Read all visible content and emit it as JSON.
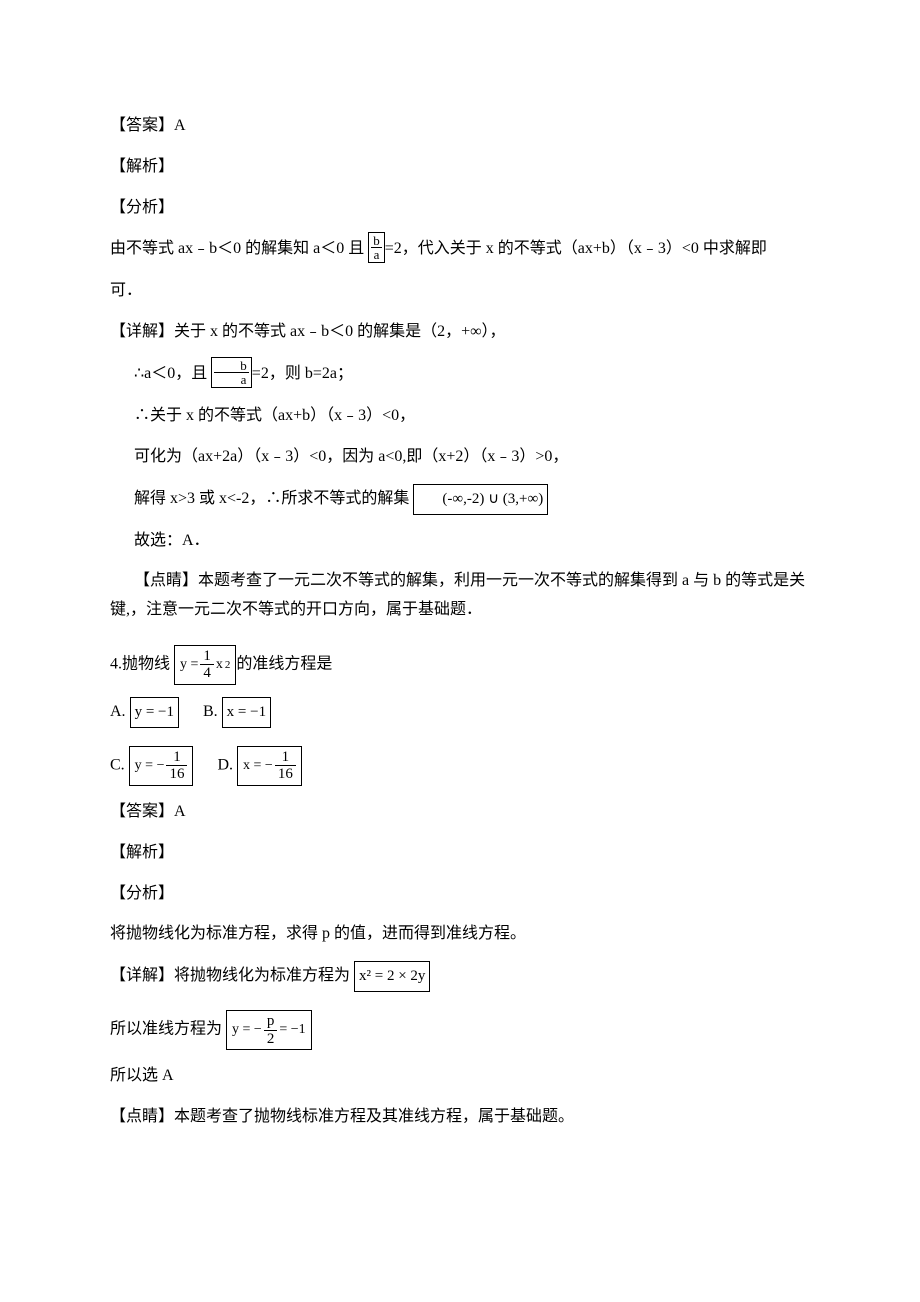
{
  "q3": {
    "ans_label": "【答案】A",
    "parse_label": "【解析】",
    "analysis_label": "【分析】",
    "reasoning_pre": "由不等式 ax﹣b＜0 的解集知 a＜0 且",
    "frac_ba": "b/a",
    "reasoning_mid": "=2，代入关于 x 的不等式（ax+b）（x﹣3）<0 中求解即",
    "reasoning_end": "可．",
    "detail_label": "【详解】关于 x 的不等式 ax﹣b＜0 的解集是（2，+∞），",
    "step1_pre": "∴a＜0，且",
    "step1_post": "=2，则 b=2a；",
    "step2": "∴关于 x 的不等式（ax+b）（x﹣3）<0，",
    "step3": "可化为（ax+2a）（x﹣3）<0，因为 a<0,即（x+2）（x﹣3）>0，",
    "step4_pre": "解得 x>3 或 x<-2，∴所求不等式的解集",
    "step4_set": "(-∞,-2) ∪ (3,+∞)",
    "choose": "故选：A．",
    "comment": "【点睛】本题考查了一元二次不等式的解集，利用一元一次不等式的解集得到 a 与 b 的等式是关键,，注意一元二次不等式的开口方向，属于基础题．"
  },
  "q4": {
    "stem_pre": "4.抛物线",
    "stem_eq": "y = (1/4)x²",
    "stem_post": "的准线方程是",
    "options": {
      "A_label": "A.",
      "A_val": "y = −1",
      "B_label": "B.",
      "B_val": "x = −1",
      "C_label": "C.",
      "C_val": "y = − 1/16",
      "D_label": "D.",
      "D_val": "x = − 1/16"
    },
    "ans_label": "【答案】A",
    "parse_label": "【解析】",
    "analysis_label": "【分析】",
    "reasoning": "将抛物线化为标准方程，求得 p 的值，进而得到准线方程。",
    "detail_pre": "【详解】将抛物线化为标准方程为",
    "detail_eq": "x² = 2 × 2y",
    "focal_pre": "所以准线方程为",
    "focal_eq": "y = − p/2 = −1",
    "choose": "所以选 A",
    "comment": "【点睛】本题考查了抛物线标准方程及其准线方程，属于基础题。"
  }
}
